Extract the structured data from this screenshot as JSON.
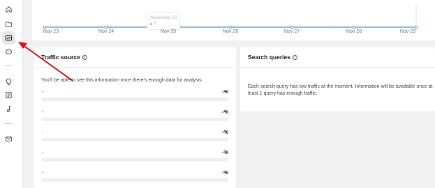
{
  "sidebar": {
    "icons": [
      "home-icon",
      "folder-icon",
      "analytics-icon",
      "comment-icon",
      "lightbulb-icon",
      "document-icon",
      "music-note-icon",
      "mail-icon"
    ],
    "active": "analytics-icon"
  },
  "chart": {
    "x_labels": [
      "Nov 23",
      "Nov 24",
      "Nov 25",
      "Nov 26",
      "Nov 27",
      "Nov 28",
      "Nov 29"
    ],
    "values": [
      0,
      0,
      0,
      0,
      0,
      0,
      0
    ],
    "tooltip": {
      "date": "November 23",
      "value": "0"
    },
    "line_color": "#4f97c6"
  },
  "traffic_source": {
    "title": "Traffic source",
    "message": "You'll be able to see this information once there's enough data for analysis.",
    "rows": [
      {
        "name": "-",
        "pct": "-%"
      },
      {
        "name": "-",
        "pct": "-%"
      },
      {
        "name": "-",
        "pct": "-%"
      },
      {
        "name": "-",
        "pct": "-%"
      },
      {
        "name": "-",
        "pct": "-%"
      }
    ]
  },
  "search_queries": {
    "title": "Search queries",
    "message": "Each search query has low traffic at the moment. Information will be available once at least 1 query has enough traffic."
  },
  "annotation_color": "#e01010"
}
